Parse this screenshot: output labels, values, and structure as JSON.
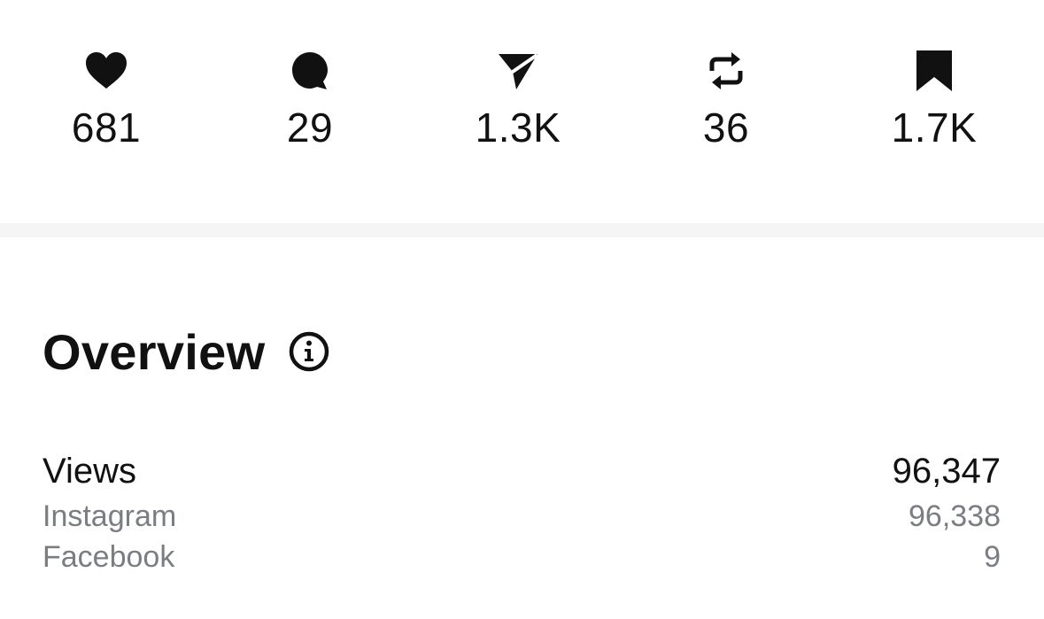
{
  "stats": [
    {
      "icon": "heart-icon",
      "count": "681"
    },
    {
      "icon": "comment-icon",
      "count": "29"
    },
    {
      "icon": "send-icon",
      "count": "1.3K"
    },
    {
      "icon": "repost-icon",
      "count": "36"
    },
    {
      "icon": "bookmark-icon",
      "count": "1.7K"
    }
  ],
  "overview": {
    "title": "Overview",
    "info_icon": "info-icon",
    "views": {
      "label": "Views",
      "value": "96,347"
    },
    "breakdown": [
      {
        "label": "Instagram",
        "value": "96,338"
      },
      {
        "label": "Facebook",
        "value": "9"
      }
    ]
  },
  "colors": {
    "text_primary": "#111111",
    "text_secondary": "#7a7d82",
    "divider": "#f5f5f5"
  }
}
